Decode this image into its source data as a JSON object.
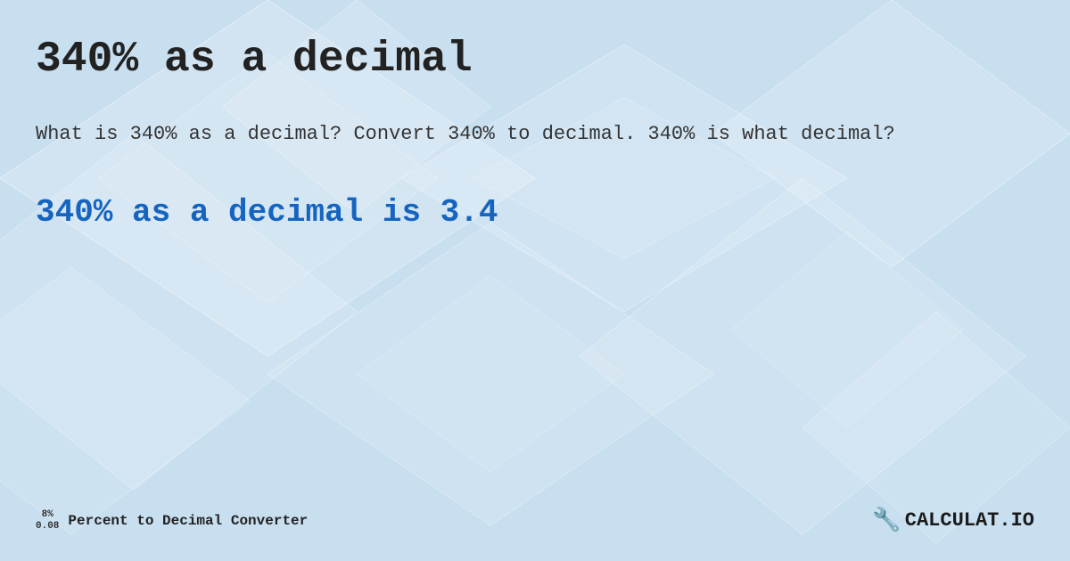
{
  "page": {
    "title": "340% as a decimal",
    "description": "What is 340% as a decimal? Convert 340% to decimal. 340% is what decimal?",
    "result": "340% as a decimal is 3.4",
    "background_color": "#c8dff0"
  },
  "footer": {
    "badge_top": "8%",
    "badge_bottom": "0.08",
    "label": "Percent to Decimal Converter",
    "logo_text": "CALCULAT.IO"
  }
}
